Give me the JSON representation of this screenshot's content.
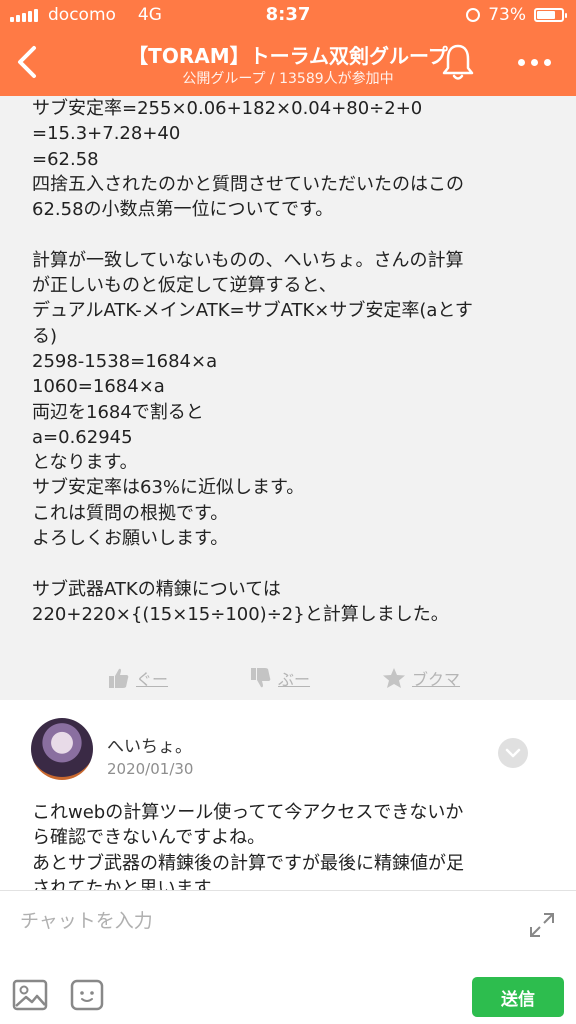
{
  "status_bar": {
    "carrier": "docomo",
    "network": "4G",
    "time": "8:37",
    "battery": "73%"
  },
  "header": {
    "title": "【TORAM】トーラム双剣グループ",
    "subtitle": "公開グループ / 13589人が参加中",
    "bg_color": "#ff7a45"
  },
  "post": {
    "lines": [
      "サブ安定率=255×0.06+182×0.04+80÷2+0",
      "=15.3+7.28+40",
      "=62.58",
      "四捨五入されたのかと質問させていただいたのはこの",
      "62.58の小数点第一位についてです。",
      "",
      "計算が一致していないものの、へいちょ。さんの計算",
      "が正しいものと仮定して逆算すると、",
      "デュアルATK-メインATK=サブATK×サブ安定率(aとす",
      "る)",
      "2598-1538=1684×a",
      "1060=1684×a",
      "両辺を1684で割ると",
      "a=0.62945",
      "となります。",
      "サブ安定率は63%に近似します。",
      "これは質問の根拠です。",
      "よろしくお願いします。",
      "",
      "サブ武器ATKの精錬については",
      "220+220×{(15×15÷100)÷2}と計算しました。"
    ],
    "actions": {
      "good": "ぐー",
      "bad": "ぶー",
      "bookmark": "ブクマ"
    }
  },
  "comment": {
    "author": "へいちょ。",
    "date": "2020/01/30",
    "lines": [
      "これwebの計算ツール使ってて今アクセスできないか",
      "ら確認できないんですよね。",
      "あとサブ武器の精錬後の計算ですが最後に精錬値が足",
      "されてたかと思います"
    ]
  },
  "input_bar": {
    "placeholder": "チャットを入力",
    "send_label": "送信",
    "send_color": "#2dbd4e"
  },
  "icons": [
    "back-icon",
    "bell-icon",
    "more-icon",
    "thumbs-up-icon",
    "thumbs-down-icon",
    "star-icon",
    "chevron-down-icon",
    "expand-icon",
    "image-icon",
    "emoji-icon"
  ]
}
